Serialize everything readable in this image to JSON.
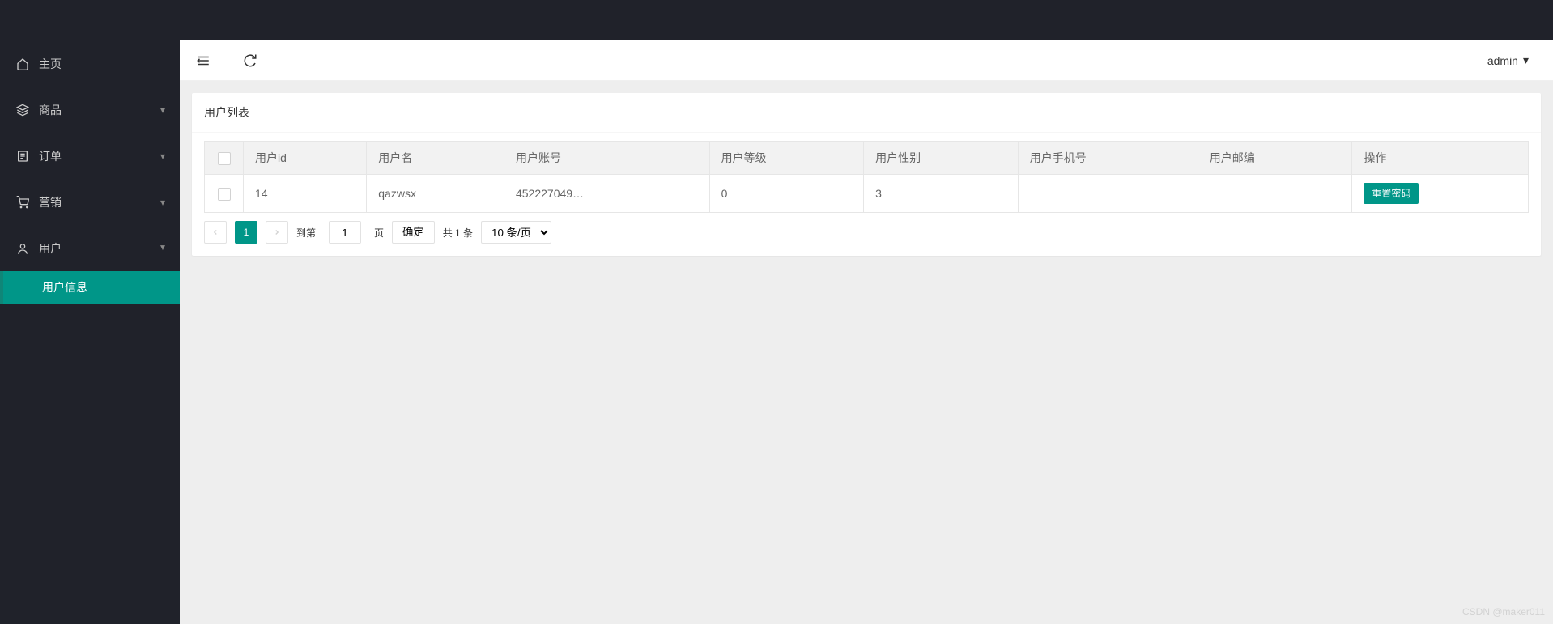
{
  "header": {
    "username": "admin"
  },
  "sidebar": {
    "items": [
      {
        "label": "主页",
        "icon": "home",
        "expandable": false
      },
      {
        "label": "商品",
        "icon": "layers",
        "expandable": true,
        "expanded": false
      },
      {
        "label": "订单",
        "icon": "document",
        "expandable": true,
        "expanded": false
      },
      {
        "label": "营销",
        "icon": "cart",
        "expandable": true,
        "expanded": false
      },
      {
        "label": "用户",
        "icon": "user",
        "expandable": true,
        "expanded": true,
        "children": [
          {
            "label": "用户信息",
            "active": true
          }
        ]
      }
    ]
  },
  "card": {
    "title": "用户列表"
  },
  "table": {
    "headers": [
      "用户id",
      "用户名",
      "用户账号",
      "用户等级",
      "用户性别",
      "用户手机号",
      "用户邮编",
      "操作"
    ],
    "rows": [
      {
        "id": "14",
        "name": "qazwsx",
        "account": "452227049…",
        "level": "0",
        "gender": "3",
        "phone": "",
        "postcode": "",
        "action_label": "重置密码"
      }
    ]
  },
  "pagination": {
    "current": "1",
    "goto_prefix": "到第",
    "goto_suffix": "页",
    "goto_value": "1",
    "confirm_label": "确定",
    "total_text": "共 1 条",
    "pagesize_label": "10 条/页"
  },
  "watermark": "CSDN @maker011"
}
